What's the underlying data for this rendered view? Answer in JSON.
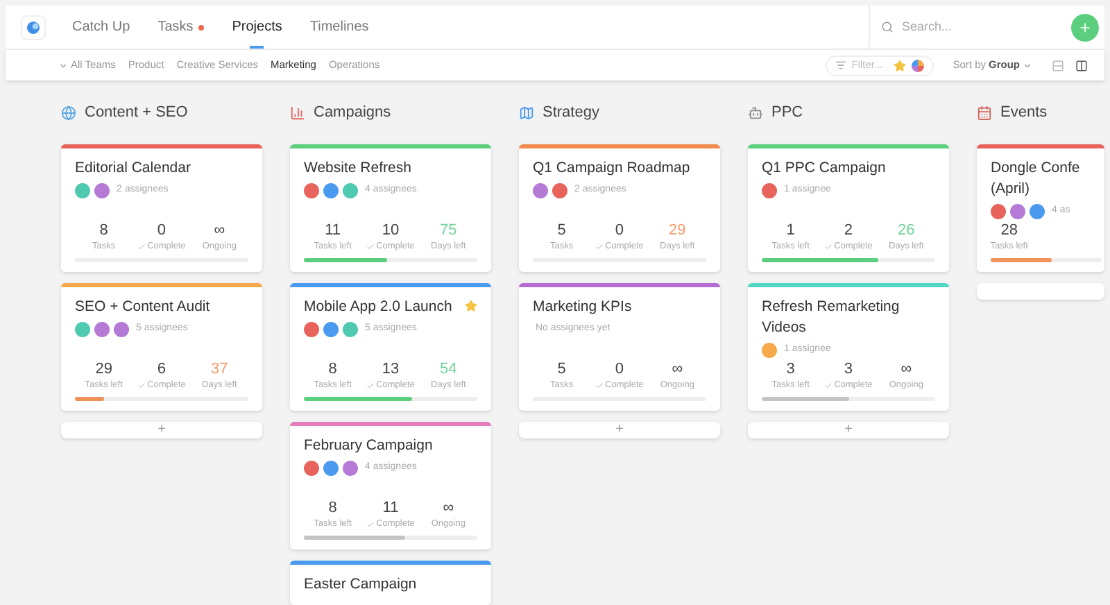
{
  "nav": {
    "tabs": [
      {
        "label": "Catch Up",
        "selected": false,
        "notification": false
      },
      {
        "label": "Tasks",
        "selected": false,
        "notification": true
      },
      {
        "label": "Projects",
        "selected": true,
        "notification": false
      },
      {
        "label": "Timelines",
        "selected": false,
        "notification": false
      }
    ],
    "search": {
      "placeholder": "Search..."
    }
  },
  "teams": {
    "all_label": "All Teams",
    "items": [
      {
        "label": "Product",
        "selected": false
      },
      {
        "label": "Creative Services",
        "selected": false
      },
      {
        "label": "Marketing",
        "selected": true
      },
      {
        "label": "Operations",
        "selected": false
      }
    ],
    "filter": {
      "placeholder": "Filter..."
    },
    "sort_prefix": "Sort by",
    "sort_value": "Group"
  },
  "columns": [
    {
      "title": "Content + SEO",
      "add": "+",
      "cards": [
        {
          "kind": "project",
          "title": "Editorial Calendar",
          "color": "#e8635c",
          "starred": false,
          "assignees": [
            {
              "color": "#4fc9b0"
            },
            {
              "color": "#b57ad6"
            }
          ],
          "assignee_text": "2 assignees",
          "stats": [
            {
              "value": "8",
              "label": "Tasks",
              "kind": "plain",
              "color": "#444444"
            },
            {
              "value": "0",
              "label": "Complete",
              "kind": "check",
              "color": "#444444"
            },
            {
              "value": "∞",
              "label": "Ongoing",
              "kind": "plain",
              "color": "#444444"
            }
          ]
        },
        {
          "kind": "project",
          "title": "SEO + Content Audit",
          "color": "#f5a94a",
          "starred": false,
          "assignees": [
            {
              "color": "#4fc9b0"
            },
            {
              "color": "#b57ad6"
            },
            {
              "color": "#b57ad6"
            }
          ],
          "assignee_text": "5 assignees",
          "stats": [
            {
              "value": "29",
              "label": "Tasks left",
              "kind": "plain",
              "color": "#444444"
            },
            {
              "value": "6",
              "label": "Complete",
              "kind": "check",
              "color": "#444444"
            },
            {
              "value": "37",
              "label": "Days left",
              "kind": "plain",
              "color": "#f39a6b"
            }
          ],
          "progress": {
            "level": 0.17,
            "color": "#f0925a"
          }
        }
      ]
    },
    {
      "title": "Campaigns",
      "cards": [
        {
          "kind": "project",
          "title": "Website Refresh",
          "color": "#5ccf7e",
          "starred": false,
          "assignees": [
            {
              "color": "#e8635c"
            },
            {
              "color": "#4a9af0"
            },
            {
              "color": "#4fc9b0"
            }
          ],
          "assignee_text": "4 assignees",
          "stats": [
            {
              "value": "11",
              "label": "Tasks left",
              "kind": "plain",
              "color": "#444444"
            },
            {
              "value": "10",
              "label": "Complete",
              "kind": "check",
              "color": "#444444"
            },
            {
              "value": "75",
              "label": "Days left",
              "kind": "plain",
              "color": "#6fd39a"
            }
          ],
          "progress": {
            "level": 0.48,
            "color": "#5ccf7e"
          }
        },
        {
          "kind": "project",
          "title": "Mobile App 2.0 Launch",
          "color": "#4a9af0",
          "starred": true,
          "assignees": [
            {
              "color": "#e8635c"
            },
            {
              "color": "#4a9af0"
            },
            {
              "color": "#4fc9b0"
            }
          ],
          "assignee_text": "5 assignees",
          "stats": [
            {
              "value": "8",
              "label": "Tasks left",
              "kind": "plain",
              "color": "#444444"
            },
            {
              "value": "13",
              "label": "Complete",
              "kind": "check",
              "color": "#444444"
            },
            {
              "value": "54",
              "label": "Days left",
              "kind": "plain",
              "color": "#6fd39a"
            }
          ],
          "progress": {
            "level": 0.62,
            "color": "#5ccf7e"
          }
        },
        {
          "kind": "project",
          "title": "February Campaign",
          "color": "#e57dbb",
          "starred": false,
          "assignees": [
            {
              "color": "#e8635c"
            },
            {
              "color": "#4a9af0"
            },
            {
              "color": "#b57ad6"
            }
          ],
          "assignee_text": "4 assignees",
          "stats": [
            {
              "value": "8",
              "label": "Tasks left",
              "kind": "plain",
              "color": "#444444"
            },
            {
              "value": "11",
              "label": "Complete",
              "kind": "check",
              "color": "#444444"
            },
            {
              "value": "∞",
              "label": "Ongoing",
              "kind": "plain",
              "color": "#444444"
            }
          ],
          "progress": {
            "level": 0.58,
            "color": "#c4c4c4"
          }
        },
        {
          "kind": "project",
          "title": "Easter Campaign",
          "color": "#4a9af0",
          "starred": false
        }
      ]
    },
    {
      "title": "Strategy",
      "add": "+",
      "cards": [
        {
          "kind": "project",
          "title": "Q1 Campaign Roadmap",
          "color": "#ef8a4f",
          "starred": false,
          "assignees": [
            {
              "color": "#b57ad6"
            },
            {
              "color": "#e8635c"
            }
          ],
          "assignee_text": "2 assignees",
          "stats": [
            {
              "value": "5",
              "label": "Tasks",
              "kind": "plain",
              "color": "#444444"
            },
            {
              "value": "0",
              "label": "Complete",
              "kind": "check",
              "color": "#444444"
            },
            {
              "value": "29",
              "label": "Days left",
              "kind": "plain",
              "color": "#f39a6b"
            }
          ]
        },
        {
          "kind": "project",
          "title": "Marketing KPIs",
          "color": "#b56cd0",
          "starred": false,
          "assignee_text": "No assignees yet",
          "stats": [
            {
              "value": "5",
              "label": "Tasks",
              "kind": "plain",
              "color": "#444444"
            },
            {
              "value": "0",
              "label": "Complete",
              "kind": "check",
              "color": "#444444"
            },
            {
              "value": "∞",
              "label": "Ongoing",
              "kind": "plain",
              "color": "#444444"
            }
          ]
        }
      ]
    },
    {
      "title": "PPC",
      "add": "+",
      "cards": [
        {
          "kind": "project",
          "title": "Q1 PPC Campaign",
          "color": "#5ccf7e",
          "starred": false,
          "assignees": [
            {
              "color": "#e8635c"
            }
          ],
          "assignee_text": "1 assignee",
          "stats": [
            {
              "value": "1",
              "label": "Tasks left",
              "kind": "plain",
              "color": "#444444"
            },
            {
              "value": "2",
              "label": "Complete",
              "kind": "check",
              "color": "#444444"
            },
            {
              "value": "26",
              "label": "Days left",
              "kind": "plain",
              "color": "#6fd39a"
            }
          ],
          "progress": {
            "level": 0.67,
            "color": "#5ccf7e"
          }
        },
        {
          "kind": "project",
          "title": "Refresh Remarketing Videos",
          "color": "#4fd6c4",
          "starred": false,
          "assignees": [
            {
              "color": "#f5a94a"
            }
          ],
          "assignee_text": "1 assignee",
          "stats": [
            {
              "value": "3",
              "label": "Tasks left",
              "kind": "plain",
              "color": "#444444"
            },
            {
              "value": "3",
              "label": "Complete",
              "kind": "check",
              "color": "#444444"
            },
            {
              "value": "∞",
              "label": "Ongoing",
              "kind": "plain",
              "color": "#444444"
            }
          ],
          "progress": {
            "level": 0.5,
            "color": "#c4c4c4"
          }
        }
      ]
    },
    {
      "title": "Events",
      "cards": [
        {
          "kind": "project",
          "title": "Dongle Confe (April)",
          "color": "#e8635c",
          "starred": false,
          "assignees": [
            {
              "color": "#e8635c"
            },
            {
              "color": "#b57ad6"
            },
            {
              "color": "#4a9af0"
            }
          ],
          "assignee_text": "4 as",
          "stats": [
            {
              "value": "28",
              "label": "Tasks left",
              "kind": "plain",
              "color": "#444444"
            }
          ],
          "progress": {
            "level": 0.55,
            "color": "#f0925a"
          }
        },
        {
          "kind": "stub"
        }
      ]
    }
  ]
}
